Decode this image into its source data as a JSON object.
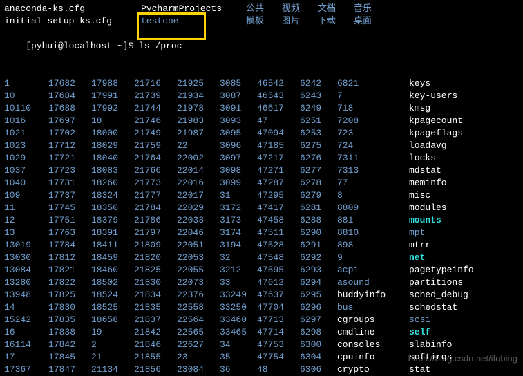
{
  "header": {
    "line1": [
      {
        "text": "anaconda-ks.cfg",
        "class": "white"
      },
      {
        "text": "PycharmProjects",
        "class": "white"
      },
      {
        "text": "公共",
        "class": "blue"
      },
      {
        "text": "视频",
        "class": "blue"
      },
      {
        "text": "文档",
        "class": "blue"
      },
      {
        "text": "音乐",
        "class": "blue"
      }
    ],
    "line2": [
      {
        "text": "initial-setup-ks.cfg",
        "class": "white"
      },
      {
        "text": "testone",
        "class": "blue"
      },
      {
        "text": "模板",
        "class": "blue"
      },
      {
        "text": "图片",
        "class": "blue"
      },
      {
        "text": "下载",
        "class": "blue"
      },
      {
        "text": "桌面",
        "class": "blue"
      }
    ],
    "prompt": "[pyhui@localhost ~]$ ",
    "command": "ls /proc"
  },
  "listing": [
    [
      {
        "t": "1",
        "c": "blue"
      },
      {
        "t": "17682",
        "c": "blue"
      },
      {
        "t": "17988",
        "c": "blue"
      },
      {
        "t": "21716",
        "c": "blue"
      },
      {
        "t": "21925",
        "c": "blue"
      },
      {
        "t": "3085",
        "c": "blue"
      },
      {
        "t": "46542",
        "c": "blue"
      },
      {
        "t": "6242",
        "c": "blue"
      },
      {
        "t": "6821",
        "c": "blue"
      },
      {
        "t": "keys",
        "c": "white"
      }
    ],
    [
      {
        "t": "10",
        "c": "blue"
      },
      {
        "t": "17684",
        "c": "blue"
      },
      {
        "t": "17991",
        "c": "blue"
      },
      {
        "t": "21739",
        "c": "blue"
      },
      {
        "t": "21934",
        "c": "blue"
      },
      {
        "t": "3087",
        "c": "blue"
      },
      {
        "t": "46543",
        "c": "blue"
      },
      {
        "t": "6243",
        "c": "blue"
      },
      {
        "t": "7",
        "c": "blue"
      },
      {
        "t": "key-users",
        "c": "white"
      }
    ],
    [
      {
        "t": "10110",
        "c": "blue"
      },
      {
        "t": "17688",
        "c": "blue"
      },
      {
        "t": "17992",
        "c": "blue"
      },
      {
        "t": "21744",
        "c": "blue"
      },
      {
        "t": "21978",
        "c": "blue"
      },
      {
        "t": "3091",
        "c": "blue"
      },
      {
        "t": "46617",
        "c": "blue"
      },
      {
        "t": "6249",
        "c": "blue"
      },
      {
        "t": "718",
        "c": "blue"
      },
      {
        "t": "kmsg",
        "c": "white"
      }
    ],
    [
      {
        "t": "1016",
        "c": "blue"
      },
      {
        "t": "17697",
        "c": "blue"
      },
      {
        "t": "18",
        "c": "blue"
      },
      {
        "t": "21746",
        "c": "blue"
      },
      {
        "t": "21983",
        "c": "blue"
      },
      {
        "t": "3093",
        "c": "blue"
      },
      {
        "t": "47",
        "c": "blue"
      },
      {
        "t": "6251",
        "c": "blue"
      },
      {
        "t": "7208",
        "c": "blue"
      },
      {
        "t": "kpagecount",
        "c": "white"
      }
    ],
    [
      {
        "t": "1021",
        "c": "blue"
      },
      {
        "t": "17702",
        "c": "blue"
      },
      {
        "t": "18000",
        "c": "blue"
      },
      {
        "t": "21749",
        "c": "blue"
      },
      {
        "t": "21987",
        "c": "blue"
      },
      {
        "t": "3095",
        "c": "blue"
      },
      {
        "t": "47094",
        "c": "blue"
      },
      {
        "t": "6253",
        "c": "blue"
      },
      {
        "t": "723",
        "c": "blue"
      },
      {
        "t": "kpageflags",
        "c": "white"
      }
    ],
    [
      {
        "t": "1023",
        "c": "blue"
      },
      {
        "t": "17712",
        "c": "blue"
      },
      {
        "t": "18029",
        "c": "blue"
      },
      {
        "t": "21759",
        "c": "blue"
      },
      {
        "t": "22",
        "c": "blue"
      },
      {
        "t": "3096",
        "c": "blue"
      },
      {
        "t": "47185",
        "c": "blue"
      },
      {
        "t": "6275",
        "c": "blue"
      },
      {
        "t": "724",
        "c": "blue"
      },
      {
        "t": "loadavg",
        "c": "white"
      }
    ],
    [
      {
        "t": "1029",
        "c": "blue"
      },
      {
        "t": "17721",
        "c": "blue"
      },
      {
        "t": "18040",
        "c": "blue"
      },
      {
        "t": "21764",
        "c": "blue"
      },
      {
        "t": "22002",
        "c": "blue"
      },
      {
        "t": "3097",
        "c": "blue"
      },
      {
        "t": "47217",
        "c": "blue"
      },
      {
        "t": "6276",
        "c": "blue"
      },
      {
        "t": "7311",
        "c": "blue"
      },
      {
        "t": "locks",
        "c": "white"
      }
    ],
    [
      {
        "t": "1037",
        "c": "blue"
      },
      {
        "t": "17723",
        "c": "blue"
      },
      {
        "t": "18083",
        "c": "blue"
      },
      {
        "t": "21766",
        "c": "blue"
      },
      {
        "t": "22014",
        "c": "blue"
      },
      {
        "t": "3098",
        "c": "blue"
      },
      {
        "t": "47271",
        "c": "blue"
      },
      {
        "t": "6277",
        "c": "blue"
      },
      {
        "t": "7313",
        "c": "blue"
      },
      {
        "t": "mdstat",
        "c": "white"
      }
    ],
    [
      {
        "t": "1040",
        "c": "blue"
      },
      {
        "t": "17731",
        "c": "blue"
      },
      {
        "t": "18260",
        "c": "blue"
      },
      {
        "t": "21773",
        "c": "blue"
      },
      {
        "t": "22016",
        "c": "blue"
      },
      {
        "t": "3099",
        "c": "blue"
      },
      {
        "t": "47287",
        "c": "blue"
      },
      {
        "t": "6278",
        "c": "blue"
      },
      {
        "t": "77",
        "c": "blue"
      },
      {
        "t": "meminfo",
        "c": "white"
      }
    ],
    [
      {
        "t": "109",
        "c": "blue"
      },
      {
        "t": "17737",
        "c": "blue"
      },
      {
        "t": "18324",
        "c": "blue"
      },
      {
        "t": "21777",
        "c": "blue"
      },
      {
        "t": "22017",
        "c": "blue"
      },
      {
        "t": "31",
        "c": "blue"
      },
      {
        "t": "47295",
        "c": "blue"
      },
      {
        "t": "6279",
        "c": "blue"
      },
      {
        "t": "8",
        "c": "blue"
      },
      {
        "t": "misc",
        "c": "white"
      }
    ],
    [
      {
        "t": "11",
        "c": "blue"
      },
      {
        "t": "17745",
        "c": "blue"
      },
      {
        "t": "18350",
        "c": "blue"
      },
      {
        "t": "21784",
        "c": "blue"
      },
      {
        "t": "22029",
        "c": "blue"
      },
      {
        "t": "3172",
        "c": "blue"
      },
      {
        "t": "47417",
        "c": "blue"
      },
      {
        "t": "6281",
        "c": "blue"
      },
      {
        "t": "8809",
        "c": "blue"
      },
      {
        "t": "modules",
        "c": "white"
      }
    ],
    [
      {
        "t": "12",
        "c": "blue"
      },
      {
        "t": "17751",
        "c": "blue"
      },
      {
        "t": "18379",
        "c": "blue"
      },
      {
        "t": "21786",
        "c": "blue"
      },
      {
        "t": "22033",
        "c": "blue"
      },
      {
        "t": "3173",
        "c": "blue"
      },
      {
        "t": "47458",
        "c": "blue"
      },
      {
        "t": "6288",
        "c": "blue"
      },
      {
        "t": "881",
        "c": "blue"
      },
      {
        "t": "mounts",
        "c": "cyan"
      }
    ],
    [
      {
        "t": "13",
        "c": "blue"
      },
      {
        "t": "17763",
        "c": "blue"
      },
      {
        "t": "18391",
        "c": "blue"
      },
      {
        "t": "21797",
        "c": "blue"
      },
      {
        "t": "22046",
        "c": "blue"
      },
      {
        "t": "3174",
        "c": "blue"
      },
      {
        "t": "47511",
        "c": "blue"
      },
      {
        "t": "6290",
        "c": "blue"
      },
      {
        "t": "8810",
        "c": "blue"
      },
      {
        "t": "mpt",
        "c": "blue"
      }
    ],
    [
      {
        "t": "13019",
        "c": "blue"
      },
      {
        "t": "17784",
        "c": "blue"
      },
      {
        "t": "18411",
        "c": "blue"
      },
      {
        "t": "21809",
        "c": "blue"
      },
      {
        "t": "22051",
        "c": "blue"
      },
      {
        "t": "3194",
        "c": "blue"
      },
      {
        "t": "47528",
        "c": "blue"
      },
      {
        "t": "6291",
        "c": "blue"
      },
      {
        "t": "898",
        "c": "blue"
      },
      {
        "t": "mtrr",
        "c": "white"
      }
    ],
    [
      {
        "t": "13030",
        "c": "blue"
      },
      {
        "t": "17812",
        "c": "blue"
      },
      {
        "t": "18459",
        "c": "blue"
      },
      {
        "t": "21820",
        "c": "blue"
      },
      {
        "t": "22053",
        "c": "blue"
      },
      {
        "t": "32",
        "c": "blue"
      },
      {
        "t": "47548",
        "c": "blue"
      },
      {
        "t": "6292",
        "c": "blue"
      },
      {
        "t": "9",
        "c": "blue"
      },
      {
        "t": "net",
        "c": "cyan"
      }
    ],
    [
      {
        "t": "13084",
        "c": "blue"
      },
      {
        "t": "17821",
        "c": "blue"
      },
      {
        "t": "18460",
        "c": "blue"
      },
      {
        "t": "21825",
        "c": "blue"
      },
      {
        "t": "22055",
        "c": "blue"
      },
      {
        "t": "3212",
        "c": "blue"
      },
      {
        "t": "47595",
        "c": "blue"
      },
      {
        "t": "6293",
        "c": "blue"
      },
      {
        "t": "acpi",
        "c": "blue"
      },
      {
        "t": "pagetypeinfo",
        "c": "white"
      }
    ],
    [
      {
        "t": "13280",
        "c": "blue"
      },
      {
        "t": "17822",
        "c": "blue"
      },
      {
        "t": "18502",
        "c": "blue"
      },
      {
        "t": "21830",
        "c": "blue"
      },
      {
        "t": "22073",
        "c": "blue"
      },
      {
        "t": "33",
        "c": "blue"
      },
      {
        "t": "47612",
        "c": "blue"
      },
      {
        "t": "6294",
        "c": "blue"
      },
      {
        "t": "asound",
        "c": "blue"
      },
      {
        "t": "partitions",
        "c": "white"
      }
    ],
    [
      {
        "t": "13948",
        "c": "blue"
      },
      {
        "t": "17825",
        "c": "blue"
      },
      {
        "t": "18524",
        "c": "blue"
      },
      {
        "t": "21834",
        "c": "blue"
      },
      {
        "t": "22376",
        "c": "blue"
      },
      {
        "t": "33249",
        "c": "blue"
      },
      {
        "t": "47637",
        "c": "blue"
      },
      {
        "t": "6295",
        "c": "blue"
      },
      {
        "t": "buddyinfo",
        "c": "white"
      },
      {
        "t": "sched_debug",
        "c": "white"
      }
    ],
    [
      {
        "t": "14",
        "c": "blue"
      },
      {
        "t": "17830",
        "c": "blue"
      },
      {
        "t": "18525",
        "c": "blue"
      },
      {
        "t": "21835",
        "c": "blue"
      },
      {
        "t": "22558",
        "c": "blue"
      },
      {
        "t": "33250",
        "c": "blue"
      },
      {
        "t": "47704",
        "c": "blue"
      },
      {
        "t": "6296",
        "c": "blue"
      },
      {
        "t": "bus",
        "c": "blue"
      },
      {
        "t": "schedstat",
        "c": "white"
      }
    ],
    [
      {
        "t": "15242",
        "c": "blue"
      },
      {
        "t": "17835",
        "c": "blue"
      },
      {
        "t": "18658",
        "c": "blue"
      },
      {
        "t": "21837",
        "c": "blue"
      },
      {
        "t": "22564",
        "c": "blue"
      },
      {
        "t": "33460",
        "c": "blue"
      },
      {
        "t": "47713",
        "c": "blue"
      },
      {
        "t": "6297",
        "c": "blue"
      },
      {
        "t": "cgroups",
        "c": "white"
      },
      {
        "t": "scsi",
        "c": "blue"
      }
    ],
    [
      {
        "t": "16",
        "c": "blue"
      },
      {
        "t": "17838",
        "c": "blue"
      },
      {
        "t": "19",
        "c": "blue"
      },
      {
        "t": "21842",
        "c": "blue"
      },
      {
        "t": "22565",
        "c": "blue"
      },
      {
        "t": "33465",
        "c": "blue"
      },
      {
        "t": "47714",
        "c": "blue"
      },
      {
        "t": "6298",
        "c": "blue"
      },
      {
        "t": "cmdline",
        "c": "white"
      },
      {
        "t": "self",
        "c": "cyan"
      }
    ],
    [
      {
        "t": "16114",
        "c": "blue"
      },
      {
        "t": "17842",
        "c": "blue"
      },
      {
        "t": "2",
        "c": "blue"
      },
      {
        "t": "21846",
        "c": "blue"
      },
      {
        "t": "22627",
        "c": "blue"
      },
      {
        "t": "34",
        "c": "blue"
      },
      {
        "t": "47753",
        "c": "blue"
      },
      {
        "t": "6300",
        "c": "blue"
      },
      {
        "t": "consoles",
        "c": "white"
      },
      {
        "t": "slabinfo",
        "c": "white"
      }
    ],
    [
      {
        "t": "17",
        "c": "blue"
      },
      {
        "t": "17845",
        "c": "blue"
      },
      {
        "t": "21",
        "c": "blue"
      },
      {
        "t": "21855",
        "c": "blue"
      },
      {
        "t": "23",
        "c": "blue"
      },
      {
        "t": "35",
        "c": "blue"
      },
      {
        "t": "47754",
        "c": "blue"
      },
      {
        "t": "6304",
        "c": "blue"
      },
      {
        "t": "cpuinfo",
        "c": "white"
      },
      {
        "t": "softirqs",
        "c": "white"
      }
    ],
    [
      {
        "t": "17367",
        "c": "blue"
      },
      {
        "t": "17847",
        "c": "blue"
      },
      {
        "t": "21134",
        "c": "blue"
      },
      {
        "t": "21856",
        "c": "blue"
      },
      {
        "t": "23084",
        "c": "blue"
      },
      {
        "t": "36",
        "c": "blue"
      },
      {
        "t": "48",
        "c": "blue"
      },
      {
        "t": "6306",
        "c": "blue"
      },
      {
        "t": "crypto",
        "c": "white"
      },
      {
        "t": "stat",
        "c": "white"
      }
    ]
  ],
  "watermark": "https://blog.csdn.net/ifubing"
}
